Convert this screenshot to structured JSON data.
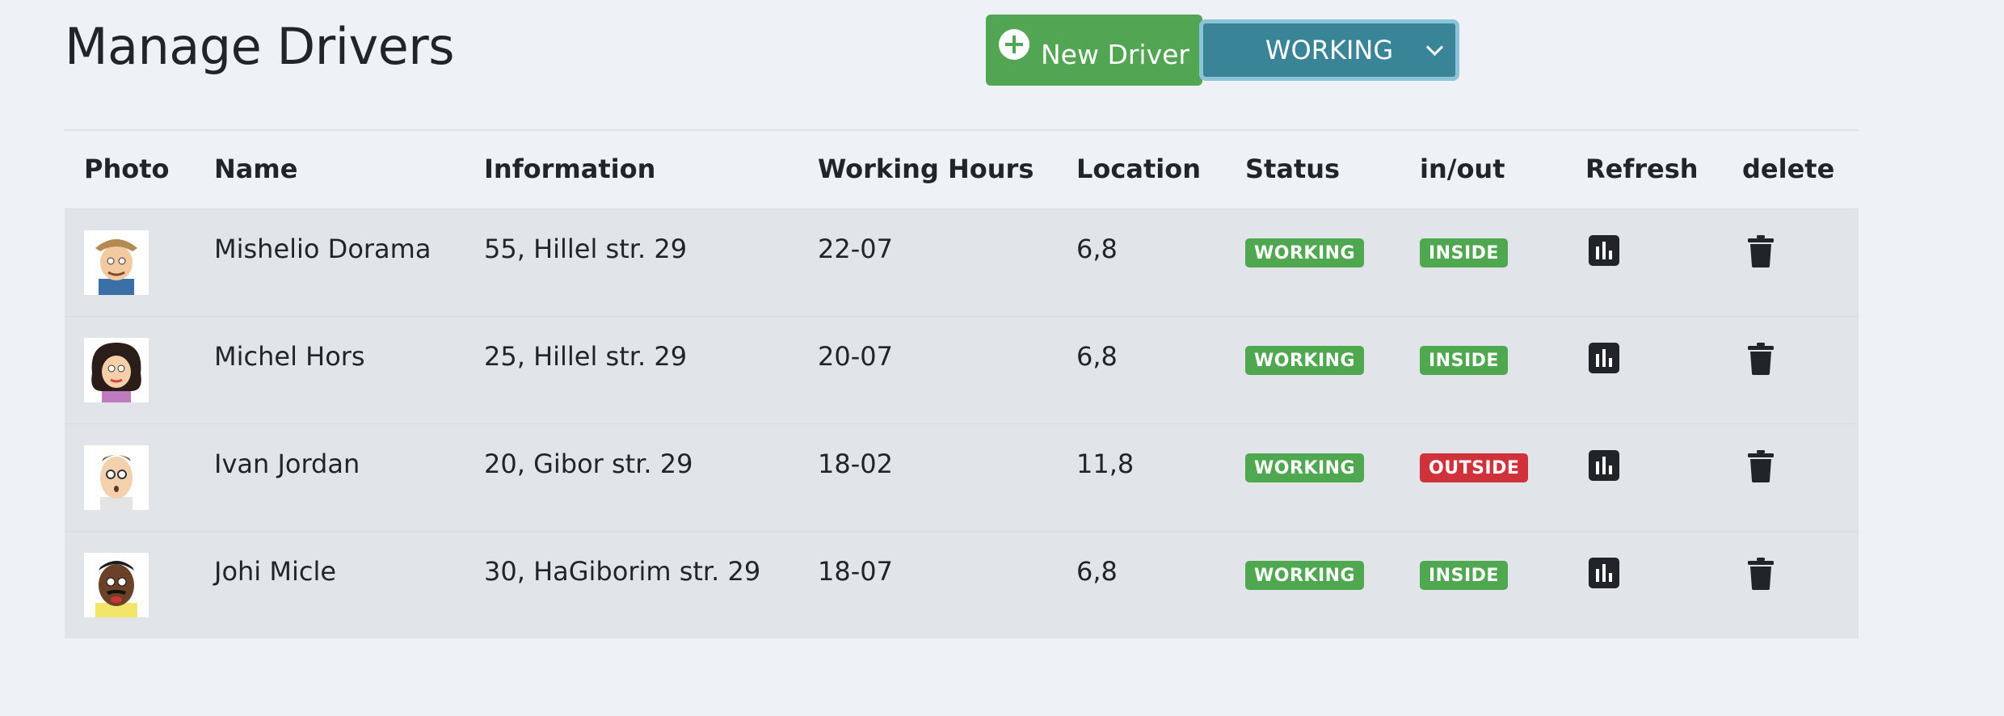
{
  "header": {
    "title": "Manage Drivers",
    "new_button_label": "New Driver",
    "status_filter": "WORKING"
  },
  "colors": {
    "success": "#52a552",
    "danger": "#d0323c",
    "select_bg": "#3a8497"
  },
  "table": {
    "columns": [
      "Photo",
      "Name",
      "Information",
      "Working Hours",
      "Location",
      "Status",
      "in/out",
      "Refresh",
      "delete"
    ],
    "rows": [
      {
        "name": "Mishelio Dorama",
        "info": "55, Hillel str. 29",
        "hours": "22-07",
        "location": "6,8",
        "status": "WORKING",
        "inout": "INSIDE",
        "avatar": "man-with-cap"
      },
      {
        "name": "Michel Hors",
        "info": "25, Hillel str. 29",
        "hours": "20-07",
        "location": "6,8",
        "status": "WORKING",
        "inout": "INSIDE",
        "avatar": "woman-dark-hair"
      },
      {
        "name": "Ivan Jordan",
        "info": "20, Gibor str. 29",
        "hours": "18-02",
        "location": "11,8",
        "status": "WORKING",
        "inout": "OUTSIDE",
        "avatar": "man-glasses"
      },
      {
        "name": "Johi Micle",
        "info": "30, HaGiborim str. 29",
        "hours": "18-07",
        "location": "6,8",
        "status": "WORKING",
        "inout": "INSIDE",
        "avatar": "man-mustache"
      }
    ]
  },
  "icons": {
    "refresh": "chart-bar-icon",
    "delete": "trash-icon",
    "add": "plus-circle-icon",
    "dropdown": "chevron-down-icon"
  }
}
